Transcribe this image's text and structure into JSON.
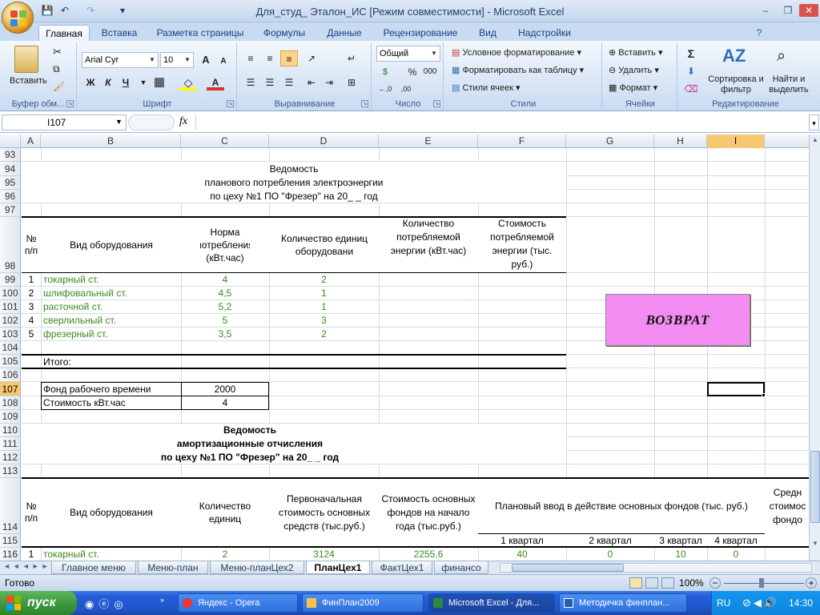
{
  "window": {
    "title": "Для_студ_ Эталон_ИС  [Режим совместимости] - Microsoft Excel",
    "minimize": "–",
    "restore": "❐",
    "close": "✕"
  },
  "quick_access": {
    "save": "💾",
    "undo": "↶",
    "redo": "↷",
    "customize": "▾"
  },
  "ribbon_tabs": [
    "Главная",
    "Вставка",
    "Разметка страницы",
    "Формулы",
    "Данные",
    "Рецензирование",
    "Вид",
    "Надстройки"
  ],
  "ribbon": {
    "clipboard": {
      "paste": "Вставить",
      "label": "Буфер обм..."
    },
    "font": {
      "name": "Arial Cyr",
      "size": "10",
      "bold": "Ж",
      "italic": "К",
      "underline": "Ч",
      "grow": "A",
      "shrink": "A",
      "color_letter": "A",
      "label": "Шрифт"
    },
    "alignment": {
      "label": "Выравнивание"
    },
    "number": {
      "format": "Общий",
      "percent": "%",
      "thousands": "000",
      "label": "Число"
    },
    "styles": {
      "conditional": "Условное форматирование",
      "as_table": "Форматировать как таблицу",
      "cell_styles": "Стили ячеек",
      "label": "Стили"
    },
    "cells": {
      "insert": "Вставить",
      "delete": "Удалить",
      "format": "Формат",
      "label": "Ячейки"
    },
    "editing": {
      "sigma": "Σ",
      "sort": "Сортировка и фильтр",
      "find": "Найти и выделить",
      "label": "Редактирование"
    }
  },
  "formula_bar": {
    "name_box": "I107",
    "fx": "fx",
    "formula": ""
  },
  "columns": [
    "A",
    "B",
    "C",
    "D",
    "E",
    "F",
    "G",
    "H",
    "I"
  ],
  "rows": [
    "93",
    "94",
    "95",
    "96",
    "97",
    "98",
    "99",
    "100",
    "101",
    "102",
    "103",
    "104",
    "105",
    "106",
    "107",
    "108",
    "109",
    "110",
    "111",
    "112",
    "113",
    "114",
    "115",
    "116"
  ],
  "sheet": {
    "t1_title1": "Ведомость",
    "t1_title2": "планового потребления электроэнергии",
    "t1_title3": "по цеху №1 ПО \"Фрезер\" на 20_ _ год",
    "t1_h_num": "№ п/п",
    "t1_h_equipment": "Вид оборудования",
    "t1_h_norm": "Норма потребления (кВт.час)",
    "t1_h_count": "Количество единиц оборудовани",
    "t1_h_energy": "Количество потребляемой энергии (кВт.час)",
    "t1_h_cost": "Стоимость потребляемой энергии (тыс. руб.)",
    "t1_rows": [
      {
        "num": "1",
        "name": "токарный ст.",
        "norm": "4",
        "count": "2"
      },
      {
        "num": "2",
        "name": "шлифовальный ст.",
        "norm": "4,5",
        "count": "1"
      },
      {
        "num": "3",
        "name": "расточной ст.",
        "norm": "5,2",
        "count": "1"
      },
      {
        "num": "4",
        "name": "сверлильный ст.",
        "norm": "5",
        "count": "3"
      },
      {
        "num": "5",
        "name": "фрезерный ст.",
        "norm": "3,5",
        "count": "2"
      }
    ],
    "t1_total": "Итого:",
    "fund_label": "Фонд рабочего времени",
    "fund_value": "2000",
    "price_label": "Стоимость кВт.час",
    "price_value": "4",
    "t2_title1": "Ведомость",
    "t2_title2": "амортизационные отчисления",
    "t2_title3": "по цеху №1 ПО \"Фрезер\" на 20_ _ год",
    "t2_h_num": "№ п/п",
    "t2_h_equipment": "Вид оборудования",
    "t2_h_count": "Количество единиц",
    "t2_h_initial": "Первоначальная стоимость основных средств (тыс.руб.)",
    "t2_h_start": "Стоимость основных фондов на начало года (тыс.руб.)",
    "t2_h_plan": "Плановый ввод в действие основных фондов (тыс. руб.)",
    "t2_h_avg": "Средн стоимос фондо",
    "t2_q1": "1 квартал",
    "t2_q2": "2 квартал",
    "t2_q3": "3 квартал",
    "t2_q4": "4 квартал",
    "t2_row1": {
      "num": "1",
      "name": "токарный ст.",
      "count": "2",
      "initial": "3124",
      "start": "2255,6",
      "q1": "40",
      "q2": "0",
      "q3": "10",
      "q4": "0"
    }
  },
  "return_button": "ВОЗВРАТ",
  "sheet_tabs": [
    "Главное меню",
    "Меню-план",
    "Меню-планЦех2",
    "ПланЦех1",
    "ФактЦех1",
    "финансо"
  ],
  "active_sheet": "ПланЦех1",
  "status": {
    "ready": "Готово",
    "zoom": "100%"
  },
  "taskbar": {
    "start": "пуск",
    "items": [
      "Яндекс - Opera",
      "ФинПлан2009",
      "Microsoft Excel - Для...",
      "Методичка финплан..."
    ],
    "lang": "RU",
    "time": "14:30"
  }
}
